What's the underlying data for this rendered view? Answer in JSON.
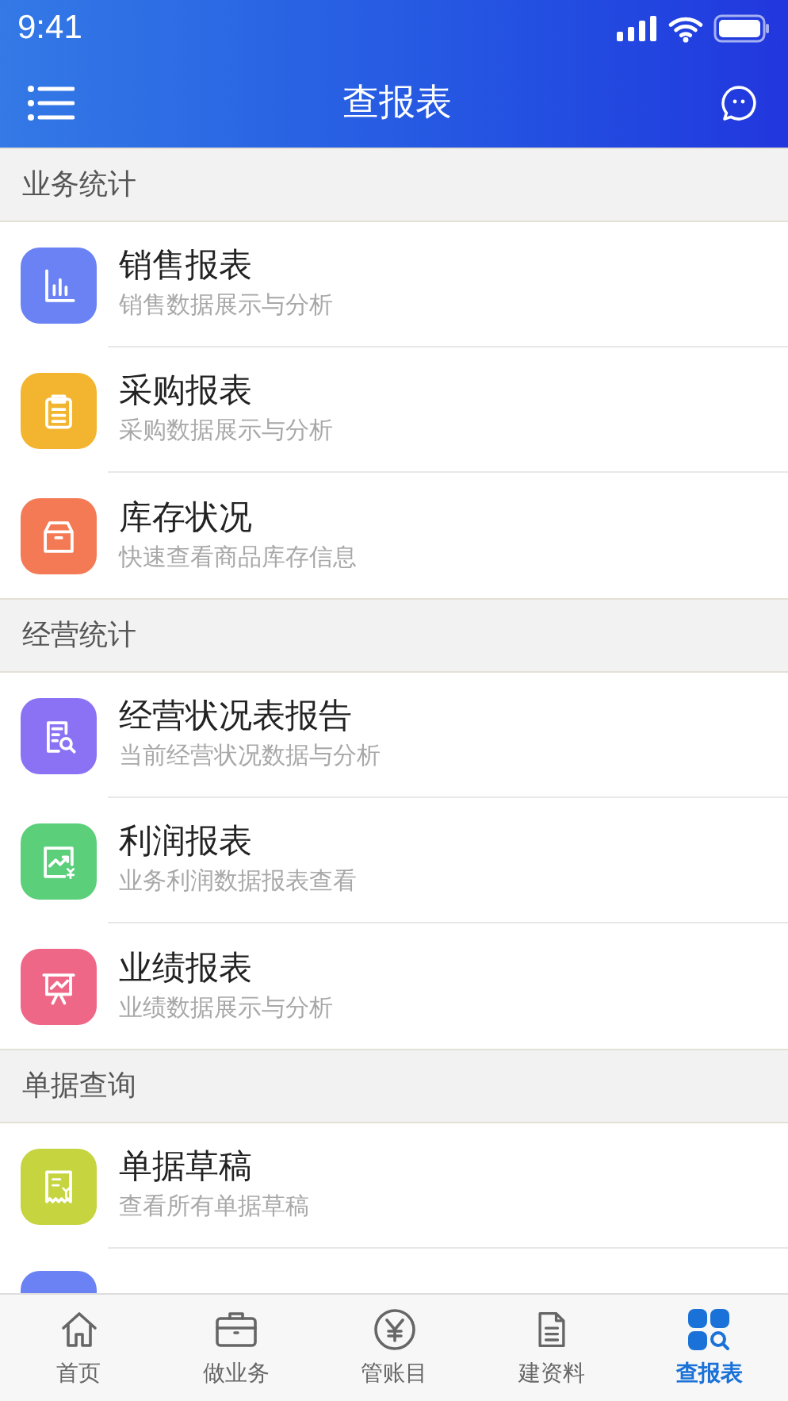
{
  "status_bar": {
    "time": "9:41"
  },
  "nav": {
    "title": "查报表"
  },
  "sections": [
    {
      "title": "业务统计",
      "items": [
        {
          "title": "销售报表",
          "subtitle": "销售数据展示与分析",
          "color": "#6a82f3"
        },
        {
          "title": "采购报表",
          "subtitle": "采购数据展示与分析",
          "color": "#f3b52f"
        },
        {
          "title": "库存状况",
          "subtitle": "快速查看商品库存信息",
          "color": "#f47a55"
        }
      ]
    },
    {
      "title": "经营统计",
      "items": [
        {
          "title": "经营状况表报告",
          "subtitle": "当前经营状况数据与分析",
          "color": "#8b72f5"
        },
        {
          "title": "利润报表",
          "subtitle": "业务利润数据报表查看",
          "color": "#5bcf7a"
        },
        {
          "title": "业绩报表",
          "subtitle": "业绩数据展示与分析",
          "color": "#ef6787"
        }
      ]
    },
    {
      "title": "单据查询",
      "items": [
        {
          "title": "单据草稿",
          "subtitle": "查看所有单据草稿",
          "color": "#c5d43f"
        },
        {
          "kind": "cut",
          "color": "#6a82f3"
        }
      ]
    }
  ],
  "tab_bar": [
    {
      "label": "首页",
      "selected": false
    },
    {
      "label": "做业务",
      "selected": false
    },
    {
      "label": "管账目",
      "selected": false
    },
    {
      "label": "建资料",
      "selected": false
    },
    {
      "label": "查报表",
      "selected": true
    }
  ]
}
